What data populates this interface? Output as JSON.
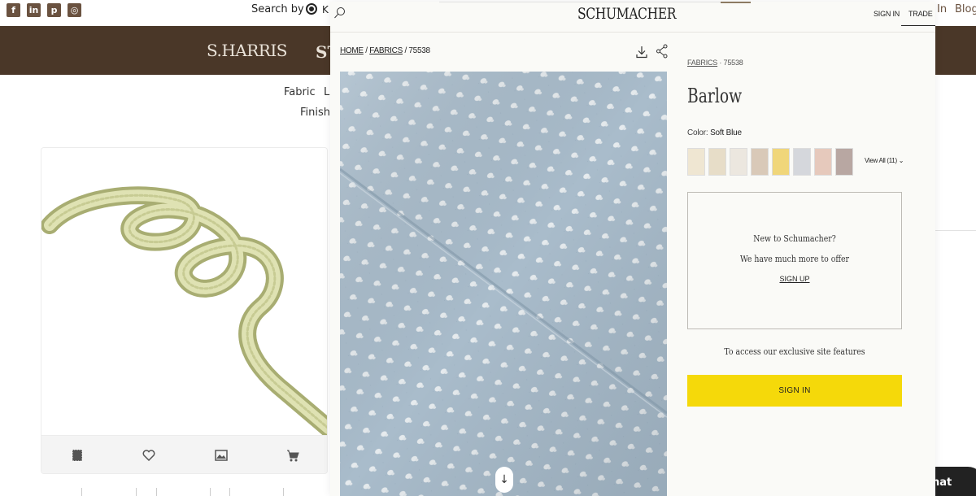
{
  "background_page": {
    "social_icons": [
      "facebook-icon",
      "linkedin-icon",
      "pinterest-icon",
      "instagram-icon"
    ],
    "search_by_label": "Search by",
    "search_by_option": "K",
    "right_top_text_1": "In",
    "right_top_text_2": "Blog",
    "brand_name": "S.HARRIS",
    "brand_partial": "ST",
    "nav": {
      "fabric": "Fabric",
      "l": "L",
      "finishes": "Finishe"
    },
    "product_card": {
      "actions": [
        "pattern-icon",
        "heart-icon",
        "image-icon",
        "cart-icon"
      ]
    },
    "chat_label": "hat"
  },
  "overlay": {
    "logo": "SCHUMACHER",
    "header": {
      "sign_in": "SIGN IN",
      "trade": "TRADE"
    },
    "breadcrumb": {
      "home": "HOME",
      "fabrics": "FABRICS",
      "sku": "75538",
      "sep": "/"
    },
    "category_crumb": {
      "category": "FABRICS",
      "sep": "·",
      "sku": "75538"
    },
    "product_title": "Barlow",
    "color_label": "Color:",
    "color_value": "Soft Blue",
    "swatches": [
      "#efe6d2",
      "#e7ddc8",
      "#ece7df",
      "#d9c9b8",
      "#f0d67a",
      "#d5d7dc",
      "#e6c9bc",
      "#b8a7a2"
    ],
    "view_all": "View All (11)",
    "promo": {
      "line1": "New to Schumacher?",
      "line2": "We have much more to offer",
      "sign_up": "SIGN UP"
    },
    "exclusive_text": "To access our exclusive site features",
    "sign_in_button": "SIGN IN",
    "scroll_down_icon": "arrow-down-icon",
    "colors": {
      "brand_brown": "#4a3728",
      "cta_yellow": "#f5d90a",
      "fabric_blue": "#a9bccb"
    }
  }
}
